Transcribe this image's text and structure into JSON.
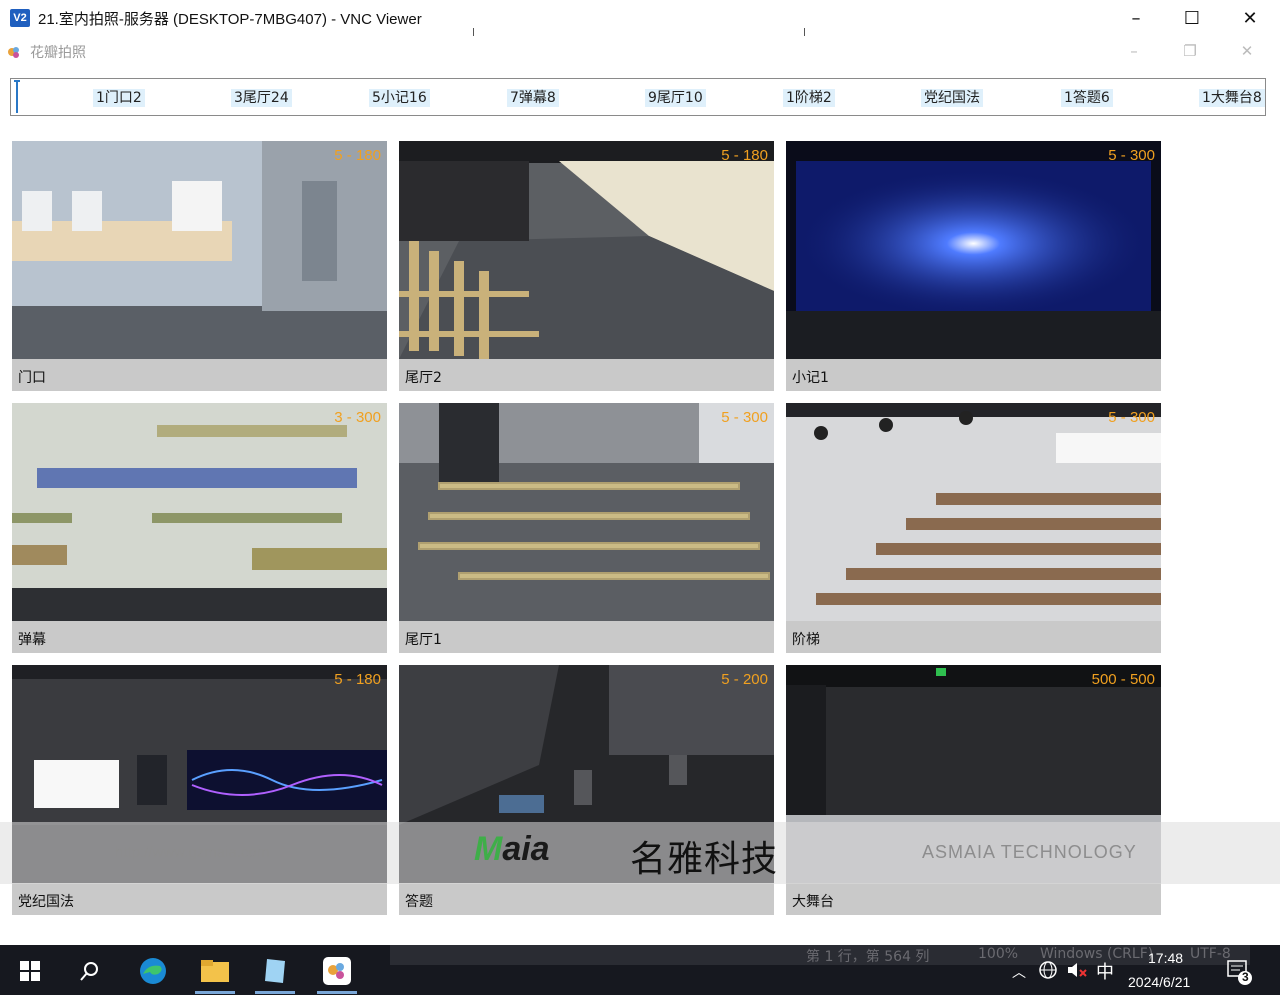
{
  "vnc_window": {
    "icon_label": "V2",
    "title": "21.室内拍照-服务器 (DESKTOP-7MBG407) - VNC Viewer",
    "minimize": "–",
    "maximize": "☐",
    "close": "✕"
  },
  "app_window": {
    "title": "花瓣拍照",
    "minimize": "–",
    "restore": "❐",
    "close": "✕"
  },
  "tab_bar": {
    "items": [
      "1门口2",
      "3尾厅24",
      "5小记16",
      "7弹幕8",
      "9尾厅10",
      "1阶梯2",
      "党纪国法",
      "1答题6",
      "1大舞台8"
    ]
  },
  "tiles": [
    {
      "caption": "门口",
      "range": "5 - 180"
    },
    {
      "caption": "尾厅2",
      "range": "5 - 180"
    },
    {
      "caption": "小记1",
      "range": "5 - 300"
    },
    {
      "caption": "弹幕",
      "range": "3 - 300"
    },
    {
      "caption": "尾厅1",
      "range": "5 - 300"
    },
    {
      "caption": "阶梯",
      "range": "5 - 300"
    },
    {
      "caption": "党纪国法",
      "range": "5 - 180"
    },
    {
      "caption": "答题",
      "range": "5 - 200"
    },
    {
      "caption": "大舞台",
      "range": "500 - 500"
    }
  ],
  "watermark": {
    "url": "http://www.gzmaia.com",
    "logo_m": "M",
    "logo_rest": "aia",
    "cn": "名雅科技",
    "en": "ASMAIA TECHNOLOGY"
  },
  "notepad_status": {
    "position": "第 1 行，第 564 列",
    "zoom": "100%",
    "eol": "Windows (CRLF)",
    "encoding": "UTF-8"
  },
  "taskbar": {
    "time": "17:48",
    "date": "2024/6/21",
    "ime": "中",
    "notifications": "3"
  },
  "colors": {
    "range_label": "#f0a020",
    "caption_bg": "#c9c9c9",
    "taskbar_bg": "#16181f",
    "tab_highlight": "#dff0fb"
  }
}
